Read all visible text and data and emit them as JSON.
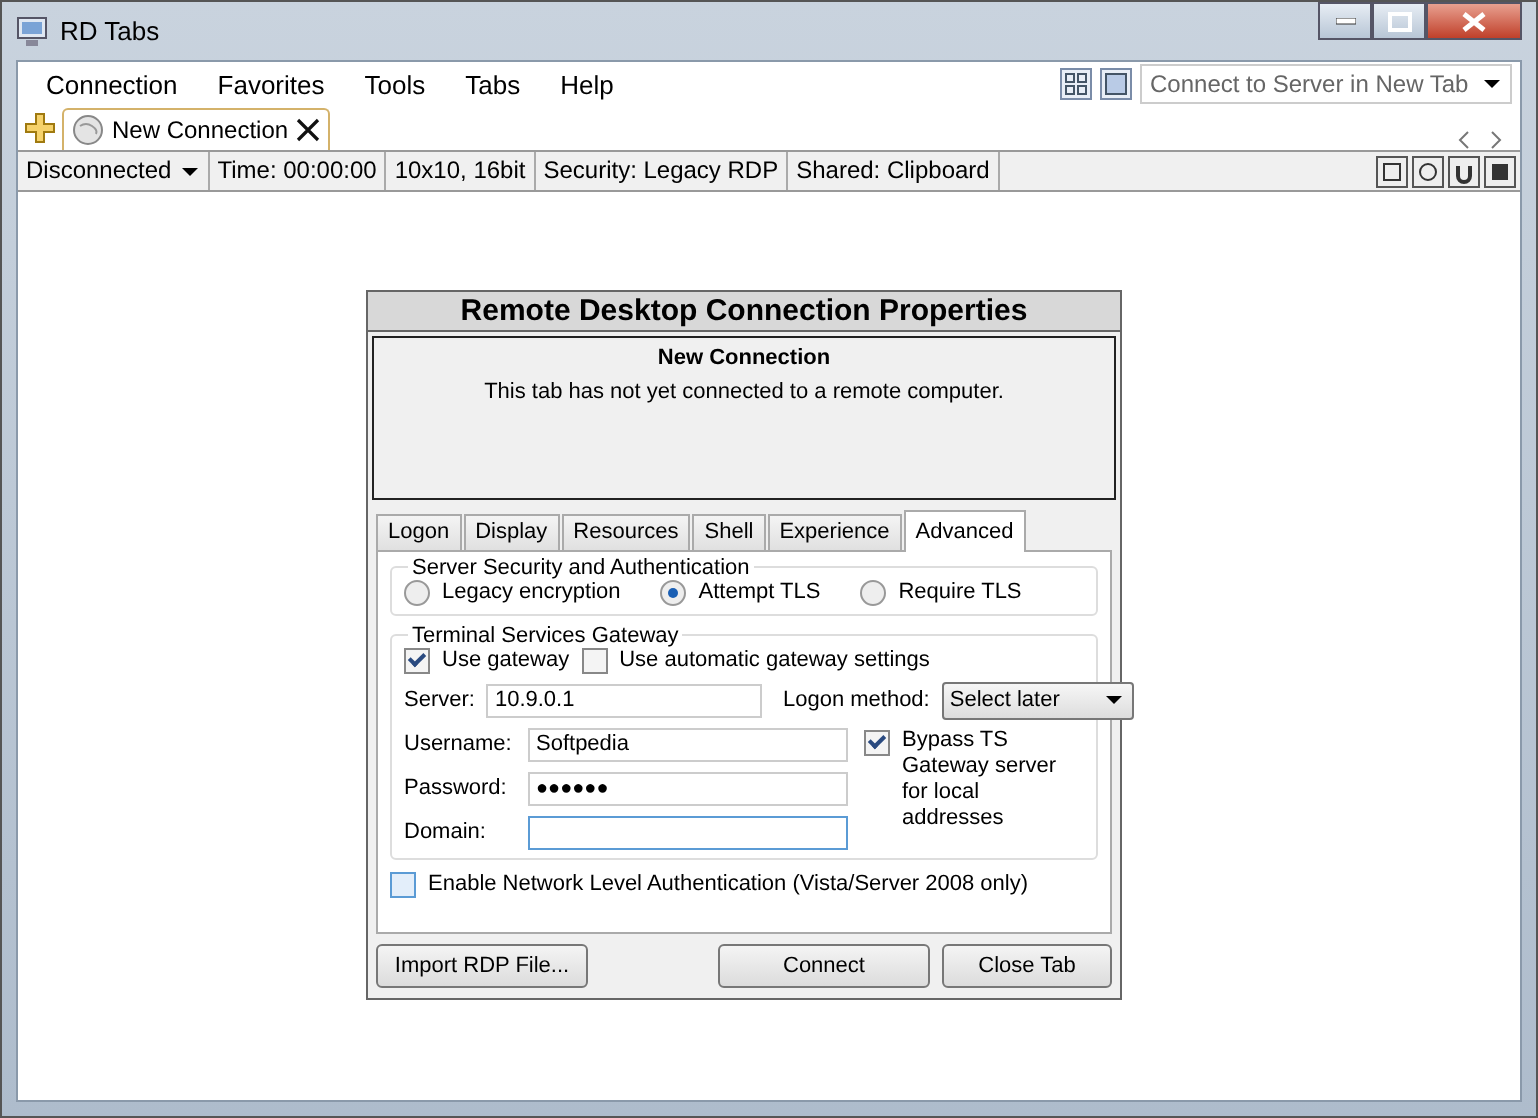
{
  "window": {
    "title": "RD Tabs"
  },
  "menu": [
    "Connection",
    "Favorites",
    "Tools",
    "Tabs",
    "Help"
  ],
  "connect_box": {
    "placeholder": "Connect to Server in New Tab"
  },
  "tabs": [
    {
      "label": "New Connection",
      "selected": true
    }
  ],
  "status_bar": {
    "state": "Disconnected",
    "fields": [
      "Time: 00:00:00",
      "10x10, 16bit",
      "Security: Legacy RDP",
      "Shared: Clipboard"
    ]
  },
  "dialog": {
    "title": "Remote Desktop Connection Properties",
    "header": {
      "title": "New Connection",
      "message": "This tab has not yet connected to a remote computer."
    },
    "tabs": [
      {
        "label": "Logon",
        "selected": false
      },
      {
        "label": "Display",
        "selected": false
      },
      {
        "label": "Resources",
        "selected": false
      },
      {
        "label": "Shell",
        "selected": false
      },
      {
        "label": "Experience",
        "selected": false
      },
      {
        "label": "Advanced",
        "selected": true
      }
    ],
    "security": {
      "legend": "Server Security and Authentication",
      "options": [
        {
          "label": "Legacy encryption",
          "selected": false
        },
        {
          "label": "Attempt TLS",
          "selected": true
        },
        {
          "label": "Require TLS",
          "selected": false
        }
      ]
    },
    "gateway": {
      "legend": "Terminal Services Gateway",
      "use_gateway": {
        "label": "Use gateway",
        "checked": true
      },
      "auto_settings": {
        "label": "Use automatic gateway settings",
        "checked": false
      },
      "server": {
        "label": "Server:",
        "value": "10.9.0.1"
      },
      "logon_method": {
        "label": "Logon method:",
        "value": "Select later"
      },
      "username": {
        "label": "Username:",
        "value": "Softpedia"
      },
      "password": {
        "label": "Password:",
        "value": "●●●●●●"
      },
      "domain": {
        "label": "Domain:",
        "focused": true
      },
      "bypass": {
        "label": "Bypass TS Gateway server for local addresses",
        "checked": true
      }
    },
    "nla": {
      "label": "Enable Network Level Authentication (Vista/Server 2008 only)",
      "checked": false
    },
    "buttons": [
      "Import RDP File...",
      "Connect",
      "Close Tab"
    ]
  }
}
